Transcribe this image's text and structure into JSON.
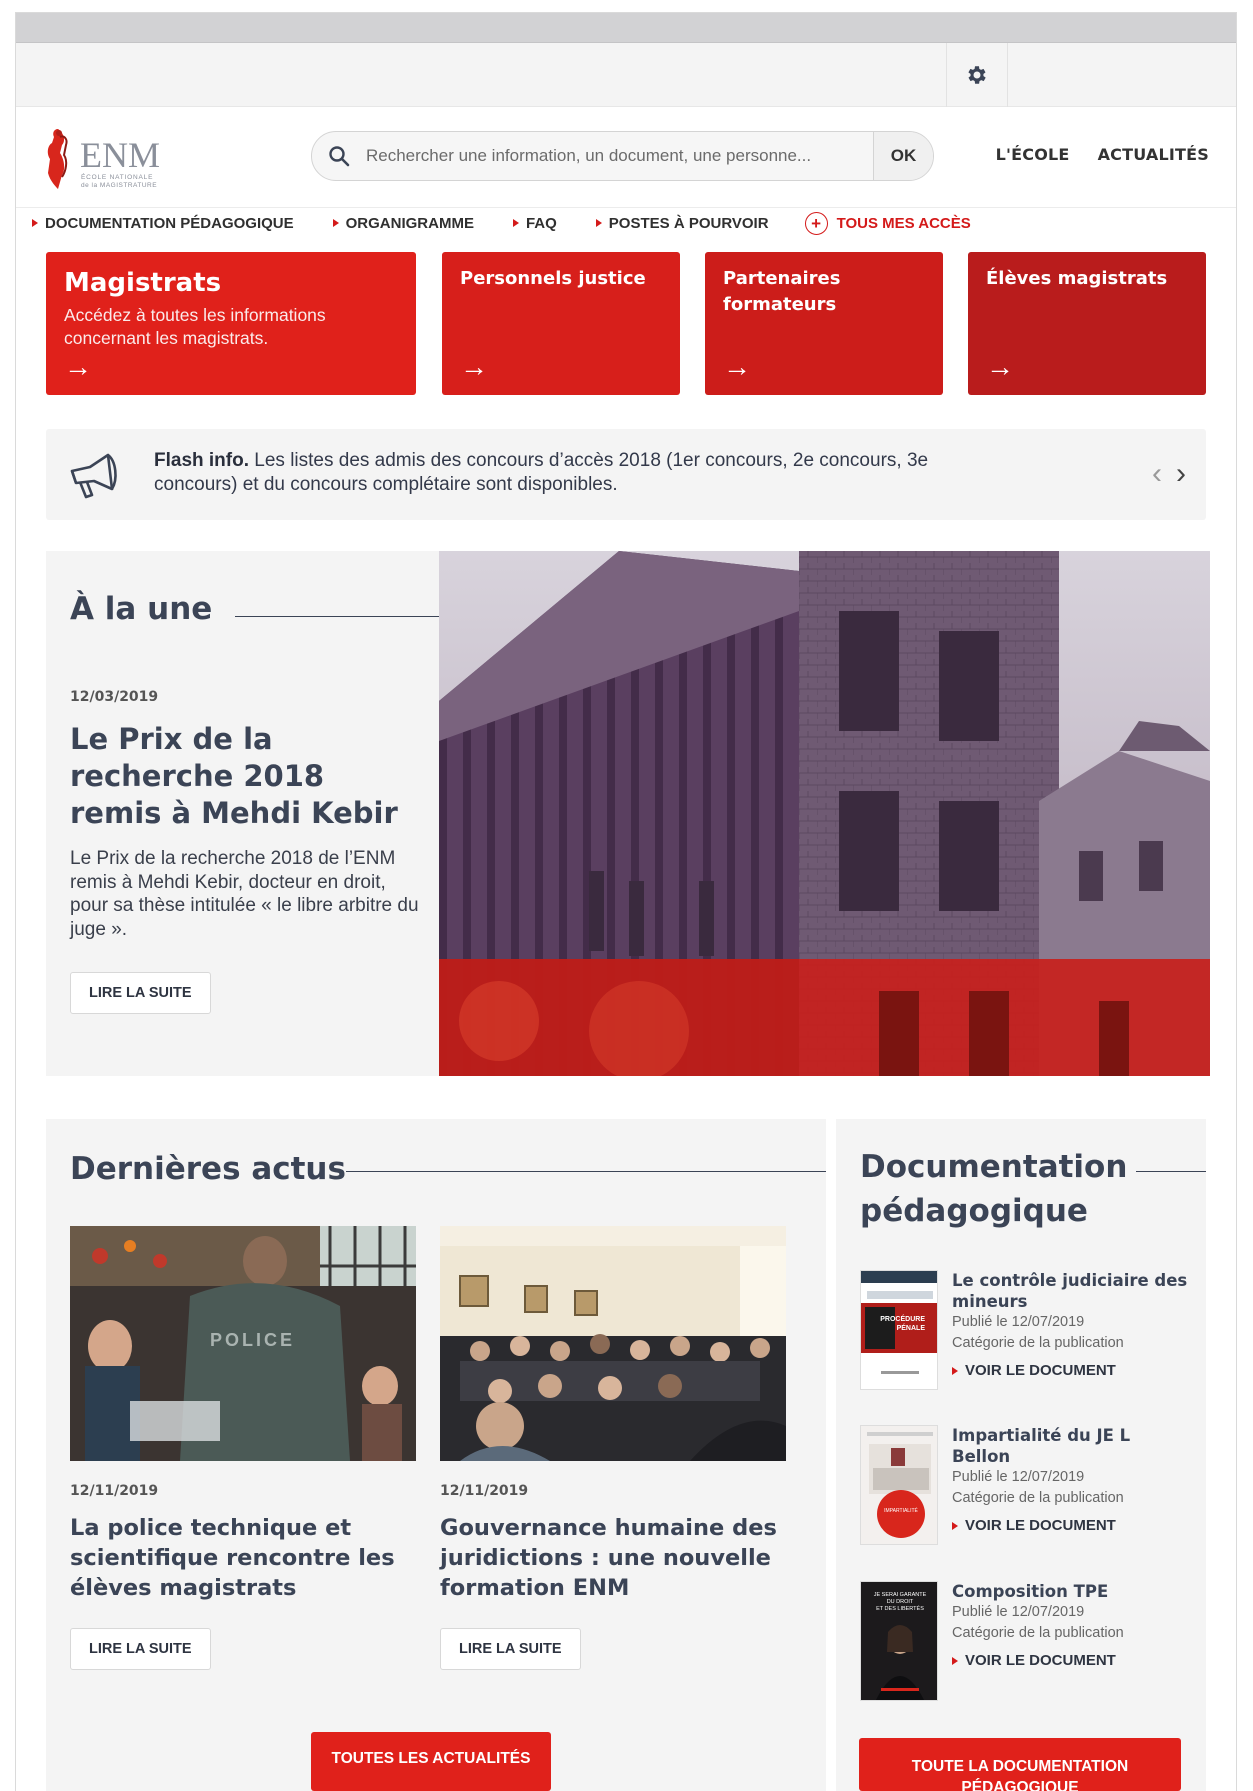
{
  "logo": {
    "text": "ENM",
    "subtitle_line1": "ÉCOLE NATIONALE",
    "subtitle_line2": "de la MAGISTRATURE"
  },
  "search": {
    "placeholder": "Rechercher une information, un document, une personne...",
    "submit_label": "OK"
  },
  "main_nav": {
    "ecole": "L'ÉCOLE",
    "actualites": "ACTUALITÉS"
  },
  "quick_links": {
    "documentation": "DOCUMENTATION PÉDAGOGIQUE",
    "organigramme": "ORGANIGRAMME",
    "faq": "FAQ",
    "postes": "POSTES À POURVOIR",
    "acces": "TOUS MES ACCÈS"
  },
  "cards": [
    {
      "title": "Magistrats",
      "desc": "Accédez à toutes les informations concernant les magistrats.",
      "arrow": "→"
    },
    {
      "title": "Personnels justice",
      "arrow": "→"
    },
    {
      "title": "Partenaires formateurs",
      "arrow": "→"
    },
    {
      "title": "Élèves magistrats",
      "arrow": "→"
    }
  ],
  "flash": {
    "label": "Flash info.",
    "text": " Les listes des admis des concours d’accès 2018 (1er concours, 2e concours, 3e concours) et du concours complétaire sont disponibles.",
    "prev": "‹",
    "next": "›"
  },
  "une": {
    "heading": "À la une",
    "date": "12/03/2019",
    "title": "Le Prix de la recherche 2018 remis à Mehdi Kebir",
    "text": "Le Prix de la recherche 2018 de l’ENM remis à Mehdi Kebir, docteur en droit, pour sa thèse intitulée « le libre arbitre du juge ».",
    "button": "LIRE LA SUITE"
  },
  "actus": {
    "heading": "Dernières actus",
    "items": [
      {
        "date": "12/11/2019",
        "title": "La police technique et scientifique rencontre les élèves magistrats",
        "button": "LIRE LA SUITE",
        "photo_text": "POLICE"
      },
      {
        "date": "12/11/2019",
        "title": "Gouvernance humaine des juridictions : une nouvelle formation ENM",
        "button": "LIRE LA SUITE"
      }
    ],
    "all_button": "TOUTES LES ACTUALITÉS"
  },
  "docs": {
    "heading": "Documentation pédagogique",
    "items": [
      {
        "title": "Le contrôle judiciaire des mineurs",
        "published": "Publié le 12/07/2019",
        "category": "Catégorie de la publication",
        "link": "VOIR LE DOCUMENT",
        "cover_text": "PROCÉDURE PÉNALE"
      },
      {
        "title": "Impartialité du JE L Bellon",
        "published": "Publié le 12/07/2019",
        "category": "Catégorie de la publication",
        "link": "VOIR LE DOCUMENT"
      },
      {
        "title": "Composition TPE",
        "published": "Publié le 12/07/2019",
        "category": "Catégorie de la publication",
        "link": "VOIR LE DOCUMENT",
        "cover_text": "JE SERAI GARANTE DU DROIT ET DES LIBERTÉS"
      }
    ],
    "all_button": "TOUTE LA DOCUMENTATION PÉDAGOGIQUE"
  },
  "colors": {
    "brand_red": "#e0211b",
    "dark_red": "#b91c1c",
    "text_dark": "#3b4456",
    "panel_bg": "#f4f4f4"
  },
  "icons": [
    "gear-icon",
    "search-icon",
    "plus-circle-icon",
    "arrow-right-icon",
    "megaphone-icon",
    "chevron-left-icon",
    "chevron-right-icon"
  ]
}
